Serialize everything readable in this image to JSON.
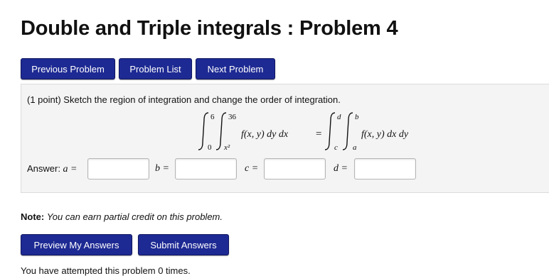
{
  "page": {
    "title": "Double and Triple integrals : Problem 4"
  },
  "nav": {
    "previous_label": "Previous Problem",
    "list_label": "Problem List",
    "next_label": "Next Problem"
  },
  "problem": {
    "statement": "(1 point) Sketch the region of integration and change the order of integration.",
    "formula": {
      "left_outer_upper": "6",
      "left_outer_lower": "0",
      "left_inner_upper": "36",
      "left_inner_lower": "x²",
      "left_integrand": "f(x, y) dy dx",
      "equals": "=",
      "right_outer_upper": "d",
      "right_outer_lower": "c",
      "right_inner_upper": "b",
      "right_inner_lower": "a",
      "right_integrand": "f(x, y) dx dy"
    },
    "answer": {
      "prefix": "Answer:",
      "a_label": "a =",
      "b_label": "b =",
      "c_label": "c =",
      "d_label": "d =",
      "a_value": "",
      "b_value": "",
      "c_value": "",
      "d_value": ""
    }
  },
  "note": {
    "label": "Note:",
    "text": "You can earn partial credit on this problem."
  },
  "actions": {
    "preview_label": "Preview My Answers",
    "submit_label": "Submit Answers"
  },
  "footer": {
    "attempts": "You have attempted this problem 0 times."
  },
  "colors": {
    "button_bg": "#1e2a93",
    "button_text": "#ffffff",
    "panel_bg": "#f4f4f4"
  }
}
